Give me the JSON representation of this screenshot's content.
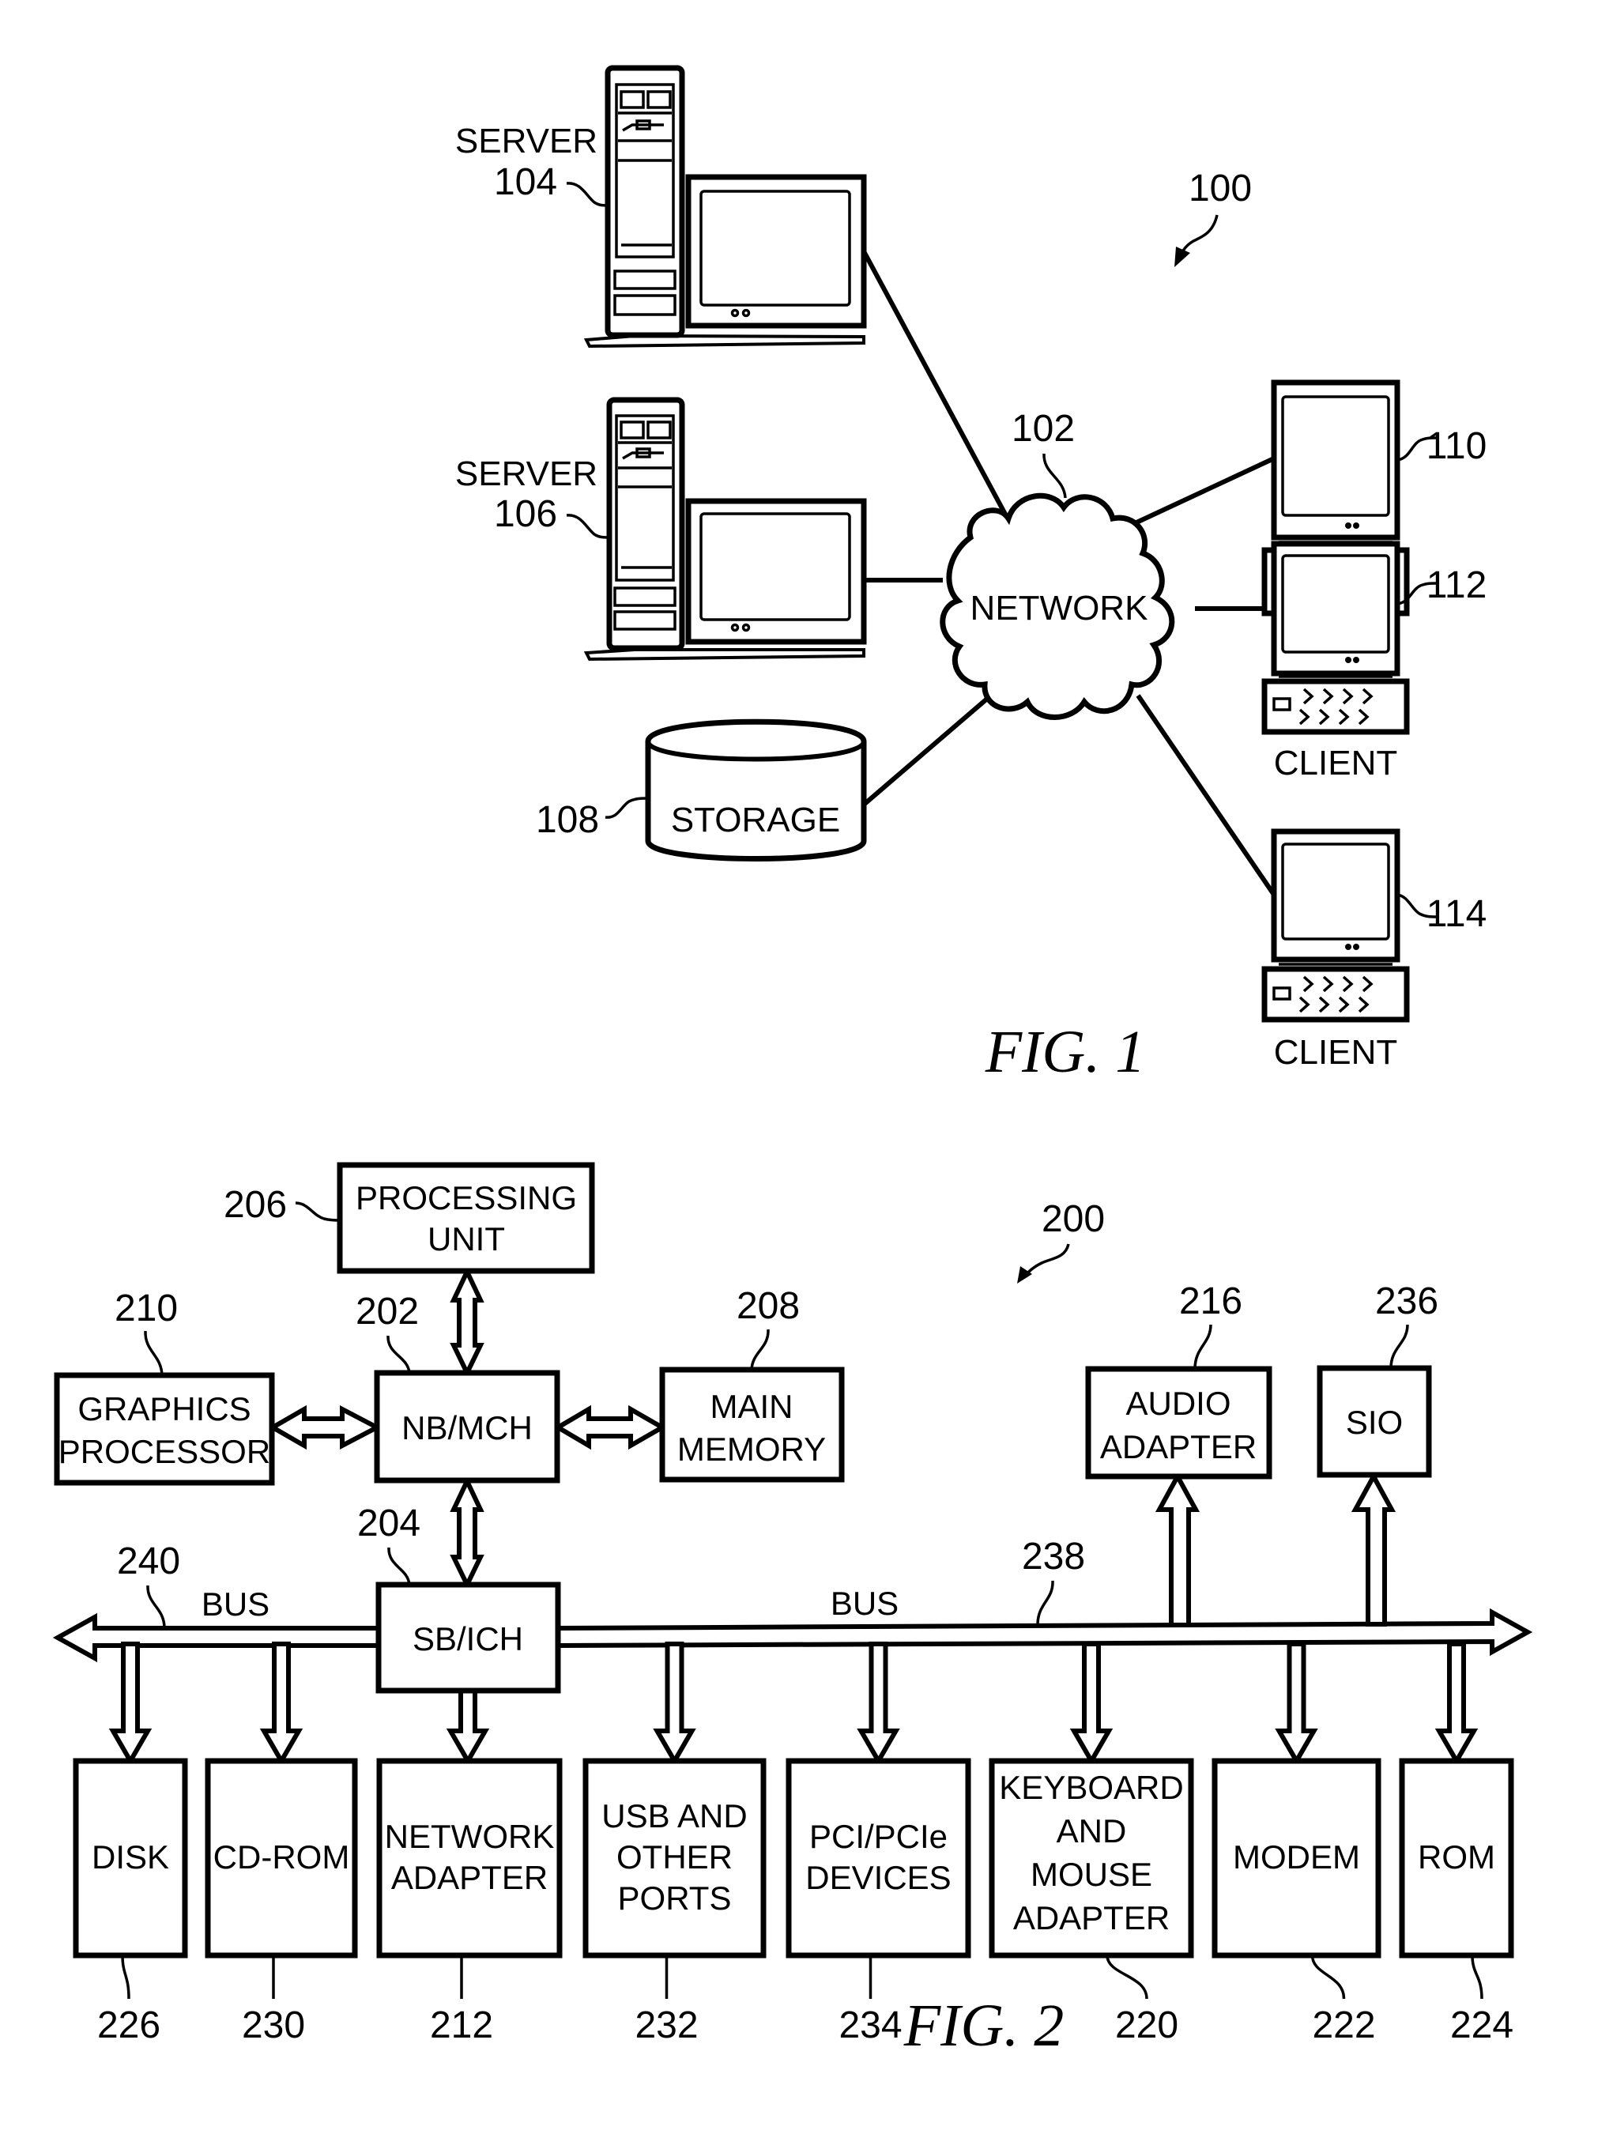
{
  "fig1": {
    "caption": "FIG. 1",
    "system_ref": "100",
    "network": {
      "label": "NETWORK",
      "ref": "102"
    },
    "servers": [
      {
        "label": "SERVER",
        "ref": "104"
      },
      {
        "label": "SERVER",
        "ref": "106"
      }
    ],
    "storage": {
      "label": "STORAGE",
      "ref": "108"
    },
    "clients": [
      {
        "label": "CLIENT",
        "ref": "110"
      },
      {
        "label": "CLIENT",
        "ref": "112"
      },
      {
        "label": "CLIENT",
        "ref": "114"
      }
    ]
  },
  "fig2": {
    "caption": "FIG. 2",
    "system_ref": "200",
    "processing_unit": {
      "lines": [
        "PROCESSING",
        "UNIT"
      ],
      "ref": "206"
    },
    "graphics_processor": {
      "lines": [
        "GRAPHICS",
        "PROCESSOR"
      ],
      "ref": "210"
    },
    "nb_mch": {
      "lines": [
        "NB/MCH"
      ],
      "ref": "202"
    },
    "main_memory": {
      "lines": [
        "MAIN",
        "MEMORY"
      ],
      "ref": "208"
    },
    "sb_ich": {
      "lines": [
        "SB/ICH"
      ],
      "ref": "204"
    },
    "audio_adapter": {
      "lines": [
        "AUDIO",
        "ADAPTER"
      ],
      "ref": "216"
    },
    "sio": {
      "lines": [
        "SIO"
      ],
      "ref": "236"
    },
    "bus_left": {
      "label": "BUS",
      "ref": "240"
    },
    "bus_right": {
      "label": "BUS",
      "ref": "238"
    },
    "devices": [
      {
        "id": "disk",
        "lines": [
          "DISK"
        ],
        "ref": "226"
      },
      {
        "id": "cd-rom",
        "lines": [
          "CD-ROM"
        ],
        "ref": "230"
      },
      {
        "id": "network-adapter",
        "lines": [
          "NETWORK",
          "ADAPTER"
        ],
        "ref": "212"
      },
      {
        "id": "usb-ports",
        "lines": [
          "USB AND",
          "OTHER",
          "PORTS"
        ],
        "ref": "232"
      },
      {
        "id": "pci-devices",
        "lines": [
          "PCI/PCIe",
          "DEVICES"
        ],
        "ref": "234"
      },
      {
        "id": "keyboard-mouse-adapter",
        "lines": [
          "KEYBOARD",
          "AND",
          "MOUSE",
          "ADAPTER"
        ],
        "ref": "220"
      },
      {
        "id": "modem",
        "lines": [
          "MODEM"
        ],
        "ref": "222"
      },
      {
        "id": "rom",
        "lines": [
          "ROM"
        ],
        "ref": "224"
      }
    ]
  }
}
